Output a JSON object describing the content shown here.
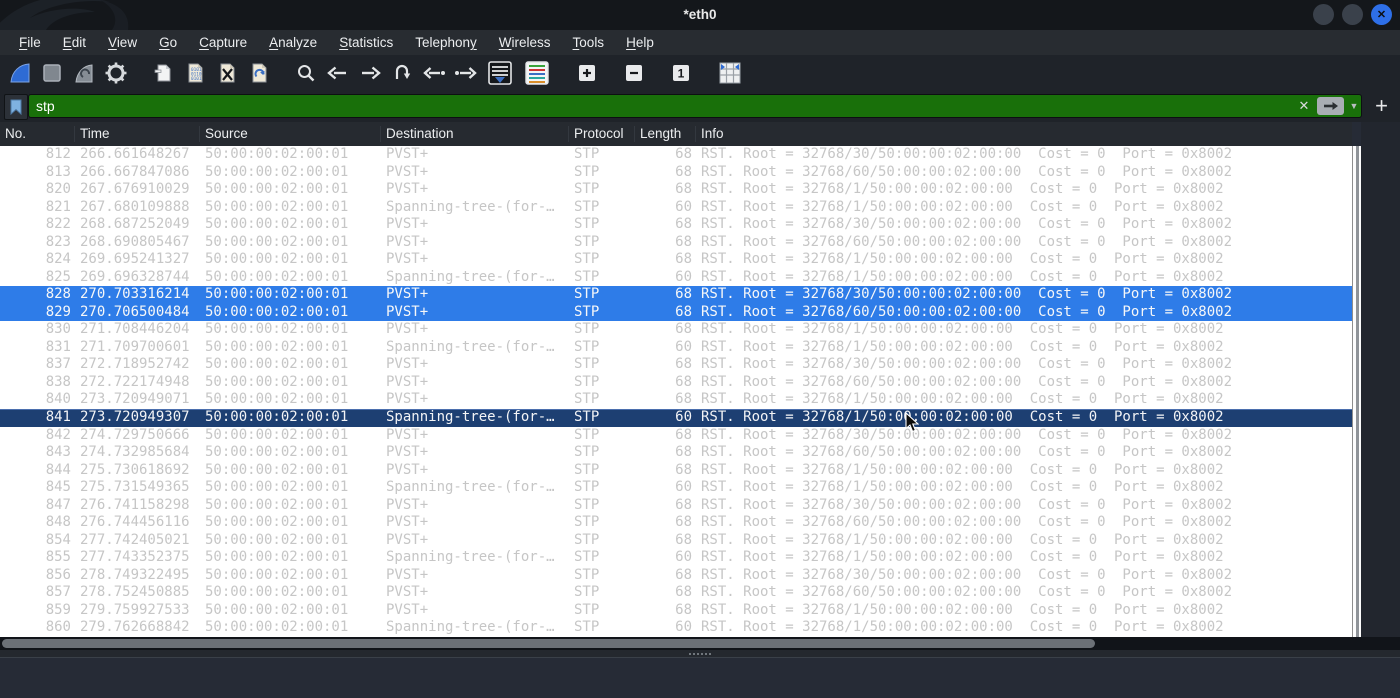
{
  "window": {
    "title": "*eth0",
    "controls": [
      "minimize",
      "maximize",
      "close"
    ]
  },
  "menu": {
    "items": [
      {
        "label": "File",
        "underline": 0
      },
      {
        "label": "Edit",
        "underline": 0
      },
      {
        "label": "View",
        "underline": 0
      },
      {
        "label": "Go",
        "underline": 0
      },
      {
        "label": "Capture",
        "underline": 0
      },
      {
        "label": "Analyze",
        "underline": 0
      },
      {
        "label": "Statistics",
        "underline": 0
      },
      {
        "label": "Telephony",
        "underline": 8
      },
      {
        "label": "Wireless",
        "underline": 0
      },
      {
        "label": "Tools",
        "underline": 0
      },
      {
        "label": "Help",
        "underline": 0
      }
    ]
  },
  "toolbar": {
    "buttons": [
      "start-capture",
      "stop-capture",
      "restart-capture",
      "capture-options",
      "open-capture-file",
      "save-capture-file",
      "close-capture-file",
      "reload-capture-file",
      "find-packet",
      "go-back",
      "go-forward",
      "go-to-packet",
      "go-first-packet",
      "go-last-packet",
      "auto-scroll",
      "colorize-packets",
      "zoom-in",
      "zoom-out",
      "zoom-original",
      "resize-columns"
    ]
  },
  "filter": {
    "value": "stp",
    "status": "valid"
  },
  "packet_table": {
    "columns": [
      "No.",
      "Time",
      "Source",
      "Destination",
      "Protocol",
      "Length",
      "Info"
    ],
    "selected_rows": [
      "828",
      "829"
    ],
    "current_row": "841",
    "rows": [
      [
        "812",
        "266.661648267",
        "50:00:00:02:00:01",
        "PVST+",
        "STP",
        "68",
        "RST. Root = 32768/30/50:00:00:02:00:00  Cost = 0  Port = 0x8002"
      ],
      [
        "813",
        "266.667847086",
        "50:00:00:02:00:01",
        "PVST+",
        "STP",
        "68",
        "RST. Root = 32768/60/50:00:00:02:00:00  Cost = 0  Port = 0x8002"
      ],
      [
        "820",
        "267.676910029",
        "50:00:00:02:00:01",
        "PVST+",
        "STP",
        "68",
        "RST. Root = 32768/1/50:00:00:02:00:00  Cost = 0  Port = 0x8002"
      ],
      [
        "821",
        "267.680109888",
        "50:00:00:02:00:01",
        "Spanning-tree-(for-…",
        "STP",
        "60",
        "RST. Root = 32768/1/50:00:00:02:00:00  Cost = 0  Port = 0x8002"
      ],
      [
        "822",
        "268.687252049",
        "50:00:00:02:00:01",
        "PVST+",
        "STP",
        "68",
        "RST. Root = 32768/30/50:00:00:02:00:00  Cost = 0  Port = 0x8002"
      ],
      [
        "823",
        "268.690805467",
        "50:00:00:02:00:01",
        "PVST+",
        "STP",
        "68",
        "RST. Root = 32768/60/50:00:00:02:00:00  Cost = 0  Port = 0x8002"
      ],
      [
        "824",
        "269.695241327",
        "50:00:00:02:00:01",
        "PVST+",
        "STP",
        "68",
        "RST. Root = 32768/1/50:00:00:02:00:00  Cost = 0  Port = 0x8002"
      ],
      [
        "825",
        "269.696328744",
        "50:00:00:02:00:01",
        "Spanning-tree-(for-…",
        "STP",
        "60",
        "RST. Root = 32768/1/50:00:00:02:00:00  Cost = 0  Port = 0x8002"
      ],
      [
        "828",
        "270.703316214",
        "50:00:00:02:00:01",
        "PVST+",
        "STP",
        "68",
        "RST. Root = 32768/30/50:00:00:02:00:00  Cost = 0  Port = 0x8002"
      ],
      [
        "829",
        "270.706500484",
        "50:00:00:02:00:01",
        "PVST+",
        "STP",
        "68",
        "RST. Root = 32768/60/50:00:00:02:00:00  Cost = 0  Port = 0x8002"
      ],
      [
        "830",
        "271.708446204",
        "50:00:00:02:00:01",
        "PVST+",
        "STP",
        "68",
        "RST. Root = 32768/1/50:00:00:02:00:00  Cost = 0  Port = 0x8002"
      ],
      [
        "831",
        "271.709700601",
        "50:00:00:02:00:01",
        "Spanning-tree-(for-…",
        "STP",
        "60",
        "RST. Root = 32768/1/50:00:00:02:00:00  Cost = 0  Port = 0x8002"
      ],
      [
        "837",
        "272.718952742",
        "50:00:00:02:00:01",
        "PVST+",
        "STP",
        "68",
        "RST. Root = 32768/30/50:00:00:02:00:00  Cost = 0  Port = 0x8002"
      ],
      [
        "838",
        "272.722174948",
        "50:00:00:02:00:01",
        "PVST+",
        "STP",
        "68",
        "RST. Root = 32768/60/50:00:00:02:00:00  Cost = 0  Port = 0x8002"
      ],
      [
        "840",
        "273.720949071",
        "50:00:00:02:00:01",
        "PVST+",
        "STP",
        "68",
        "RST. Root = 32768/1/50:00:00:02:00:00  Cost = 0  Port = 0x8002"
      ],
      [
        "841",
        "273.720949307",
        "50:00:00:02:00:01",
        "Spanning-tree-(for-…",
        "STP",
        "60",
        "RST. Root = 32768/1/50:00:00:02:00:00  Cost = 0  Port = 0x8002"
      ],
      [
        "842",
        "274.729750666",
        "50:00:00:02:00:01",
        "PVST+",
        "STP",
        "68",
        "RST. Root = 32768/30/50:00:00:02:00:00  Cost = 0  Port = 0x8002"
      ],
      [
        "843",
        "274.732985684",
        "50:00:00:02:00:01",
        "PVST+",
        "STP",
        "68",
        "RST. Root = 32768/60/50:00:00:02:00:00  Cost = 0  Port = 0x8002"
      ],
      [
        "844",
        "275.730618692",
        "50:00:00:02:00:01",
        "PVST+",
        "STP",
        "68",
        "RST. Root = 32768/1/50:00:00:02:00:00  Cost = 0  Port = 0x8002"
      ],
      [
        "845",
        "275.731549365",
        "50:00:00:02:00:01",
        "Spanning-tree-(for-…",
        "STP",
        "60",
        "RST. Root = 32768/1/50:00:00:02:00:00  Cost = 0  Port = 0x8002"
      ],
      [
        "847",
        "276.741158298",
        "50:00:00:02:00:01",
        "PVST+",
        "STP",
        "68",
        "RST. Root = 32768/30/50:00:00:02:00:00  Cost = 0  Port = 0x8002"
      ],
      [
        "848",
        "276.744456116",
        "50:00:00:02:00:01",
        "PVST+",
        "STP",
        "68",
        "RST. Root = 32768/60/50:00:00:02:00:00  Cost = 0  Port = 0x8002"
      ],
      [
        "854",
        "277.742405021",
        "50:00:00:02:00:01",
        "PVST+",
        "STP",
        "68",
        "RST. Root = 32768/1/50:00:00:02:00:00  Cost = 0  Port = 0x8002"
      ],
      [
        "855",
        "277.743352375",
        "50:00:00:02:00:01",
        "Spanning-tree-(for-…",
        "STP",
        "60",
        "RST. Root = 32768/1/50:00:00:02:00:00  Cost = 0  Port = 0x8002"
      ],
      [
        "856",
        "278.749322495",
        "50:00:00:02:00:01",
        "PVST+",
        "STP",
        "68",
        "RST. Root = 32768/30/50:00:00:02:00:00  Cost = 0  Port = 0x8002"
      ],
      [
        "857",
        "278.752450885",
        "50:00:00:02:00:01",
        "PVST+",
        "STP",
        "68",
        "RST. Root = 32768/60/50:00:00:02:00:00  Cost = 0  Port = 0x8002"
      ],
      [
        "859",
        "279.759927533",
        "50:00:00:02:00:01",
        "PVST+",
        "STP",
        "68",
        "RST. Root = 32768/1/50:00:00:02:00:00  Cost = 0  Port = 0x8002"
      ],
      [
        "860",
        "279.762668842",
        "50:00:00:02:00:01",
        "Spanning-tree-(for-…",
        "STP",
        "60",
        "RST. Root = 32768/1/50:00:00:02:00:00  Cost = 0  Port = 0x8002"
      ]
    ]
  },
  "colors": {
    "filter_valid_bg": "#19700a",
    "selected_row_bg": "#2e7ce8",
    "current_row_bg": "#1d3f72",
    "row_text": "#c6c6c6",
    "close_button": "#2e6fe8",
    "capture_fin": "#2e6bd4"
  }
}
